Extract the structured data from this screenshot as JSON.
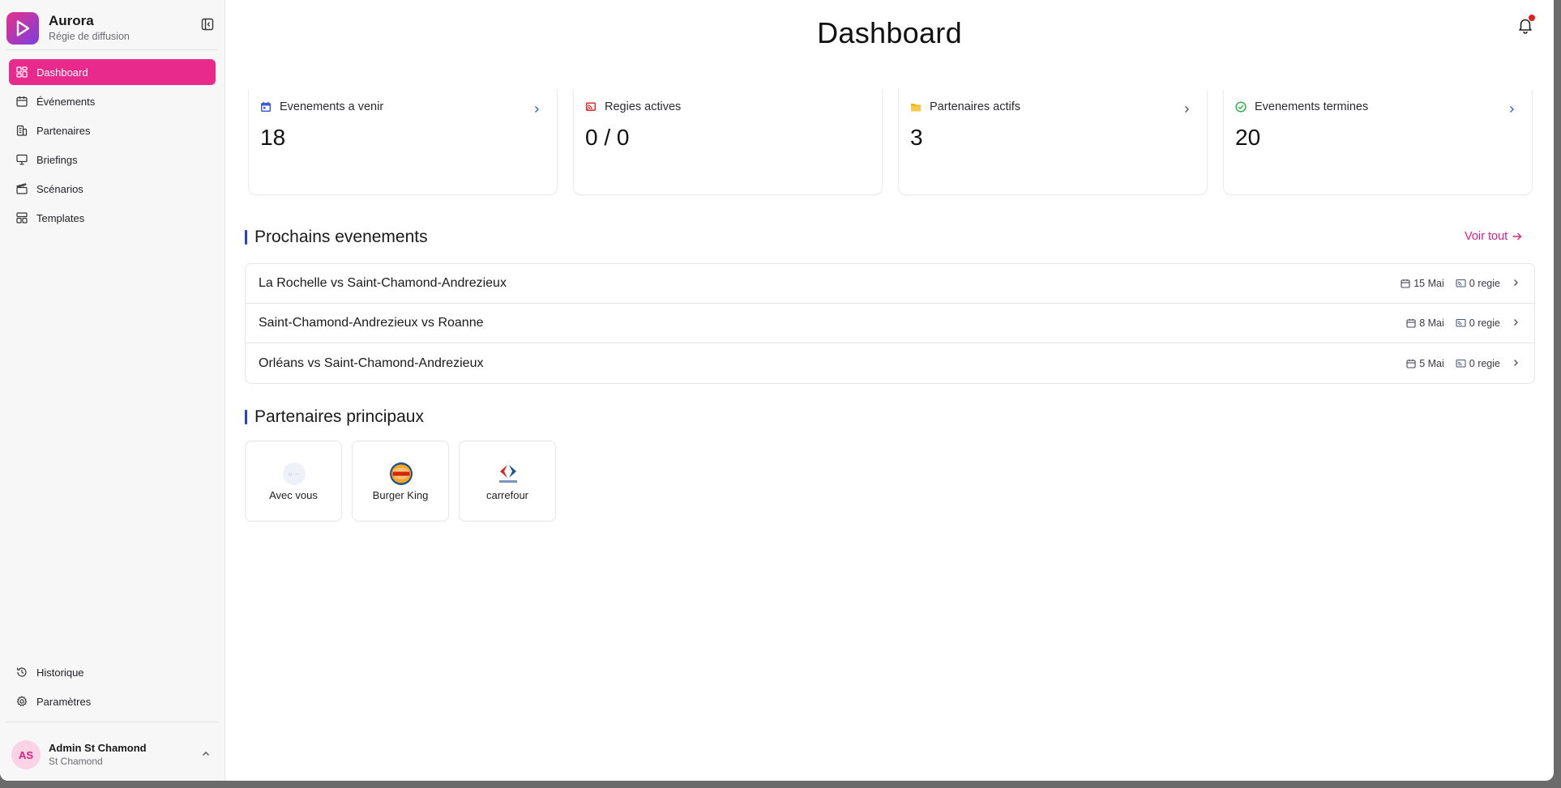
{
  "sidebar": {
    "brand": {
      "name": "Aurora",
      "subtitle": "Régie de diffusion"
    },
    "items": [
      {
        "label": "Dashboard",
        "icon": "dashboard-icon",
        "active": true
      },
      {
        "label": "Événements",
        "icon": "calendar-icon"
      },
      {
        "label": "Partenaires",
        "icon": "building-icon"
      },
      {
        "label": "Briefings",
        "icon": "presentation-icon"
      },
      {
        "label": "Scénarios",
        "icon": "clapperboard-icon"
      },
      {
        "label": "Templates",
        "icon": "layout-icon"
      }
    ],
    "bottom_items": [
      {
        "label": "Historique",
        "icon": "history-icon"
      },
      {
        "label": "Paramètres",
        "icon": "gear-icon"
      }
    ],
    "user": {
      "initials": "AS",
      "name": "Admin St Chamond",
      "org": "St Chamond"
    }
  },
  "header": {
    "title": "Dashboard"
  },
  "stats": [
    {
      "label": "Evenements a venir",
      "value": "18",
      "icon": "calendar-icon",
      "color": "#3b5bdb"
    },
    {
      "label": "Regies actives",
      "value": "0 / 0",
      "icon": "cast-icon",
      "color": "#e03131"
    },
    {
      "label": "Partenaires actifs",
      "value": "3",
      "icon": "folder-icon",
      "color": "#f2b400"
    },
    {
      "label": "Evenements termines",
      "value": "20",
      "icon": "check-circle-icon",
      "color": "#2fb344"
    }
  ],
  "upcoming": {
    "title": "Prochains evenements",
    "see_all": "Voir tout",
    "events": [
      {
        "name": "La Rochelle vs Saint-Chamond-Andrezieux",
        "date": "15 Mai",
        "regies": "0 regie"
      },
      {
        "name": "Saint-Chamond-Andrezieux vs Roanne",
        "date": "8 Mai",
        "regies": "0 regie"
      },
      {
        "name": "Orléans vs Saint-Chamond-Andrezieux",
        "date": "5 Mai",
        "regies": "0 regie"
      }
    ]
  },
  "partners": {
    "title": "Partenaires principaux",
    "items": [
      {
        "name": "Avec vous"
      },
      {
        "name": "Burger King"
      },
      {
        "name": "carrefour"
      }
    ]
  },
  "colors": {
    "accent": "#e82a8c",
    "section_bar": "#2b3fd0"
  }
}
